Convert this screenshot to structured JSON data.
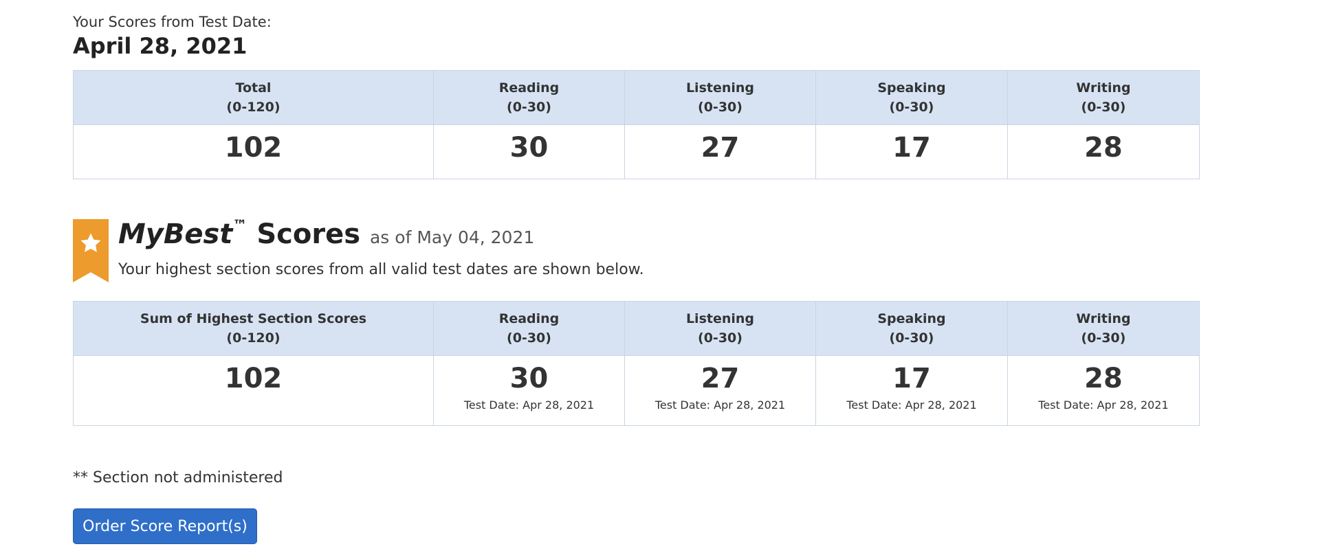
{
  "test_date": {
    "label": "Your Scores from Test Date:",
    "value": "April 28, 2021"
  },
  "test_scores": {
    "headers": [
      {
        "name": "Total",
        "range": "(0-120)"
      },
      {
        "name": "Reading",
        "range": "(0-30)"
      },
      {
        "name": "Listening",
        "range": "(0-30)"
      },
      {
        "name": "Speaking",
        "range": "(0-30)"
      },
      {
        "name": "Writing",
        "range": "(0-30)"
      }
    ],
    "values": [
      "102",
      "30",
      "27",
      "17",
      "28"
    ]
  },
  "mybest": {
    "icon": "star-icon",
    "brand": "MyBest",
    "trademark": "™",
    "title_suffix": "Scores",
    "as_of": "as of May 04, 2021",
    "description": "Your highest section scores from all valid test dates are shown below.",
    "headers": [
      {
        "name": "Sum of Highest Section Scores",
        "range": "(0-120)"
      },
      {
        "name": "Reading",
        "range": "(0-30)"
      },
      {
        "name": "Listening",
        "range": "(0-30)"
      },
      {
        "name": "Speaking",
        "range": "(0-30)"
      },
      {
        "name": "Writing",
        "range": "(0-30)"
      }
    ],
    "values": [
      "102",
      "30",
      "27",
      "17",
      "28"
    ],
    "test_dates": [
      "Test Date: Apr 28, 2021",
      "Test Date: Apr 28, 2021",
      "Test Date: Apr 28, 2021",
      "Test Date: Apr 28, 2021"
    ]
  },
  "footnote": "** Section not administered",
  "order_button_label": "Order Score Report(s)",
  "colors": {
    "header_bg": "#d7e3f3",
    "ribbon": "#ec9b2c",
    "button": "#2f6fc9"
  }
}
